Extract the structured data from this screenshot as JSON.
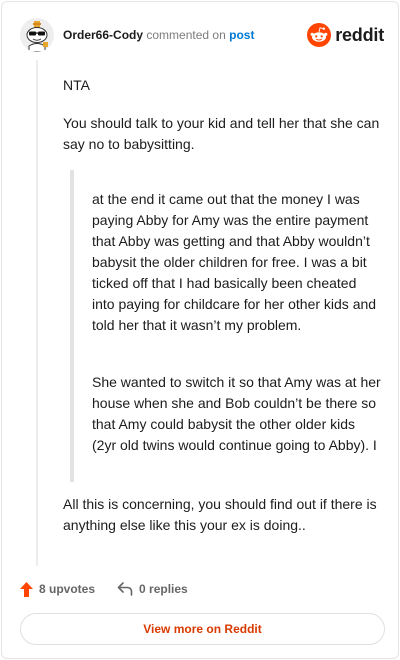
{
  "header": {
    "username": "Order66-Cody",
    "verb": "commented on",
    "post_link": "post",
    "brand": "reddit",
    "icons": {
      "avatar": "snoo-avatar-icon",
      "logo": "reddit-logo-icon"
    }
  },
  "comment": {
    "paragraphs": [
      "NTA",
      "You should talk to your kid and tell her that she can say no to babysitting."
    ],
    "quote": [
      "at the end it came out that the money I was paying Abby for Amy was the entire payment that Abby was getting and that Abby wouldn’t babysit the older children for free. I was a bit ticked off that I had basically been cheated into paying for childcare for her other kids and told her that it wasn’t my problem.",
      "She wanted to switch it so that Amy was at her house when she and Bob couldn’t be there so that Amy could babysit the other older kids (2yr old twins would continue going to Abby). I"
    ],
    "closing": "All this is concerning, you should find out if there is anything else like this your ex is doing.."
  },
  "footer": {
    "upvotes": "8 upvotes",
    "replies": "0 replies",
    "view_more": "View more on Reddit",
    "icons": {
      "upvote": "upvote-arrow-icon",
      "reply": "reply-arrow-icon"
    }
  },
  "colors": {
    "accent": "#ff4500",
    "link": "#0079d3",
    "cta": "#d93a00"
  }
}
